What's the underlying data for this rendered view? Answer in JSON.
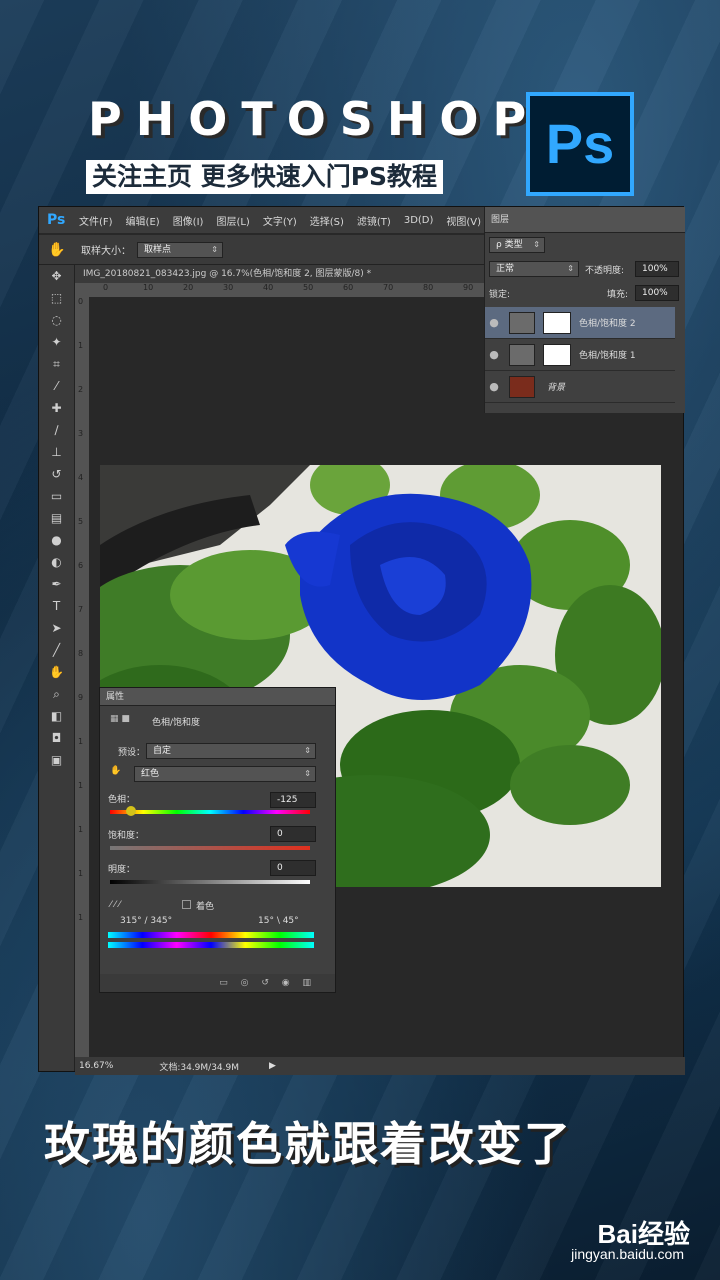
{
  "header": {
    "title": "PHOTOSHOP",
    "subtitle": "关注主页  更多快速入门PS教程",
    "logo": "Ps"
  },
  "app": {
    "logo": "Ps",
    "menu": [
      "文件(F)",
      "编辑(E)",
      "图像(I)",
      "图层(L)",
      "文字(Y)",
      "选择(S)",
      "滤镜(T)",
      "3D(D)",
      "视图(V)"
    ],
    "options": {
      "sample_size_label": "取样大小：",
      "sample_size_value": "取样点"
    },
    "doc_tab": "IMG_20180821_083423.jpg @ 16.7%(色相/饱和度 2, 图层蒙版/8) *",
    "ruler_ticks": [
      "0",
      "10",
      "20",
      "30",
      "40",
      "50",
      "60",
      "70",
      "80",
      "90"
    ],
    "ruler_v_ticks": [
      "0",
      "1",
      "2",
      "3",
      "4",
      "5",
      "6",
      "7",
      "8",
      "9",
      "1",
      "1",
      "1",
      "1",
      "1"
    ],
    "status": {
      "zoom": "16.67%",
      "doc": "文档:34.9M/34.9M"
    }
  },
  "layers": {
    "title": "图层",
    "filter_label": "ρ 类型",
    "blend_mode": "正常",
    "opacity_label": "不透明度:",
    "opacity": "100%",
    "lock_label": "锁定:",
    "fill_label": "填充:",
    "fill": "100%",
    "items": [
      {
        "name": "色相/饱和度 2",
        "selected": true
      },
      {
        "name": "色相/饱和度 1",
        "selected": false
      },
      {
        "name": "背景",
        "selected": false
      }
    ]
  },
  "properties": {
    "title": "属性",
    "adjustment": "色相/饱和度",
    "preset_label": "预设：",
    "preset": "自定",
    "channel": "红色",
    "hue_label": "色相：",
    "hue": "-125",
    "sat_label": "饱和度：",
    "sat": "0",
    "light_label": "明度：",
    "light": "0",
    "colorize_label": "着色",
    "range_left": "315° / 345°",
    "range_right": "15° \\ 45°"
  },
  "caption": "玫瑰的颜色就跟着改变了",
  "watermark": {
    "brand": "Bai经验",
    "url": "jingyan.baidu.com"
  }
}
